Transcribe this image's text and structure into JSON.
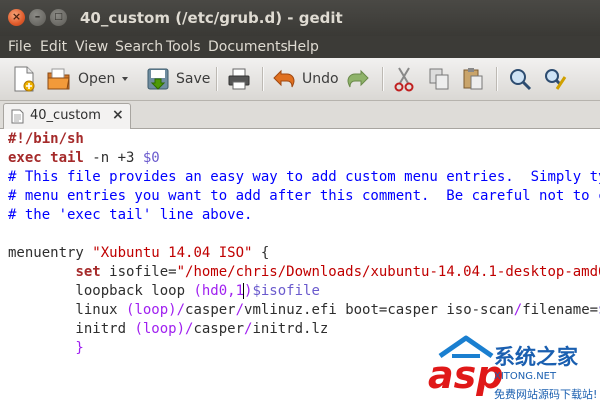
{
  "window": {
    "title": "40_custom (/etc/grub.d) - gedit"
  },
  "menubar": {
    "items": [
      "File",
      "Edit",
      "View",
      "Search",
      "Tools",
      "Documents",
      "Help"
    ]
  },
  "toolbar": {
    "open_label": "Open",
    "save_label": "Save",
    "undo_label": "Undo",
    "icons": [
      "new-document-icon",
      "open-folder-icon",
      "dropdown-arrow-icon",
      "save-icon",
      "print-icon",
      "undo-icon",
      "redo-icon",
      "cut-icon",
      "copy-icon",
      "paste-icon",
      "search-icon",
      "replace-icon"
    ]
  },
  "tabs": [
    {
      "label": "40_custom",
      "close": "×"
    }
  ],
  "editor": {
    "lines": {
      "l1": "#!/bin/sh",
      "l2a": "exec tail",
      "l2b": " -n +3 ",
      "l2c": "$0",
      "l3": "# This file provides an easy way to add custom menu entries.  Simply ty",
      "l4": "# menu entries you want to add after this comment.  Be careful not to c",
      "l5": "# the 'exec tail' line above.",
      "l7a": "menuentry ",
      "l7b": "\"Xubuntu 14.04 ISO\"",
      "l7c": " {",
      "l8a": "        ",
      "l8b": "set",
      "l8c": " isofile=",
      "l8d": "\"/home/chris/Downloads/xubuntu-14.04.1-desktop-amd6",
      "l9a": "        loopback loop ",
      "l9b": "(hd0,1",
      "l9c": ")",
      "l9d": "$isofile",
      "l10a": "        linux ",
      "l10b": "(loop)",
      "l10c": "/",
      "l10d": "casper",
      "l10e": "/",
      "l10f": "vmlinuz.efi boot=casper iso-scan",
      "l10g": "/",
      "l10h": "filename=",
      "l10i": "$",
      "l11a": "        initrd ",
      "l11b": "(loop)",
      "l11c": "/",
      "l11d": "casper",
      "l11e": "/",
      "l11f": "initrd.lz",
      "l12": "        }"
    }
  },
  "watermark": {
    "brand": "asp",
    "cn": "系统之家",
    "sub": "免费网站源码下载站!",
    "domain": "XITONG.NET"
  },
  "colors": {
    "keyword": "#a52a2a",
    "string": "#c00000",
    "variable": "#6a5acd",
    "comment": "#0000ff",
    "paren": "#a020f0"
  }
}
